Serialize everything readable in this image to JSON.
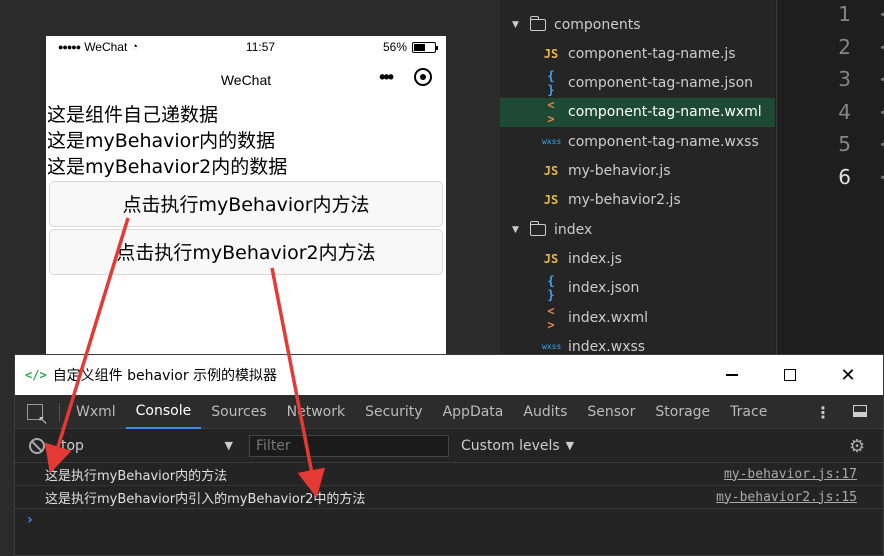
{
  "phone": {
    "status": {
      "signal": "●●●●●",
      "carrier": "WeChat",
      "time": "11:57",
      "battery": "56%",
      "battery_level": 0.56
    },
    "nav_title": "WeChat",
    "texts": [
      "这是组件自己递数据",
      "这是myBehavior内的数据",
      "这是myBehavior2内的数据"
    ],
    "buttons": [
      "点击执行myBehavior内方法",
      "点击执行myBehavior2内方法"
    ]
  },
  "tree": {
    "items": [
      {
        "type": "folder",
        "label": "components",
        "icon": "folder-icon"
      },
      {
        "type": "js",
        "label": "component-tag-name.js",
        "icon": "js-file-icon",
        "glyph": "JS"
      },
      {
        "type": "json",
        "label": "component-tag-name.json",
        "icon": "json-file-icon",
        "glyph": "{ }"
      },
      {
        "type": "wxml",
        "label": "component-tag-name.wxml",
        "icon": "wxml-file-icon",
        "glyph": "< >",
        "selected": true
      },
      {
        "type": "wxss",
        "label": "component-tag-name.wxss",
        "icon": "wxss-file-icon",
        "glyph": "wxss"
      },
      {
        "type": "js",
        "label": "my-behavior.js",
        "icon": "js-file-icon",
        "glyph": "JS"
      },
      {
        "type": "js",
        "label": "my-behavior2.js",
        "icon": "js-file-icon",
        "glyph": "JS"
      },
      {
        "type": "folder",
        "label": "index",
        "icon": "folder-icon"
      },
      {
        "type": "js",
        "label": "index.js",
        "icon": "js-file-icon",
        "glyph": "JS"
      },
      {
        "type": "json",
        "label": "index.json",
        "icon": "json-file-icon",
        "glyph": "{ }"
      },
      {
        "type": "wxml",
        "label": "index.wxml",
        "icon": "wxml-file-icon",
        "glyph": "< >"
      },
      {
        "type": "wxss",
        "label": "index.wxss",
        "icon": "wxss-file-icon",
        "glyph": "wxss"
      }
    ]
  },
  "editor": {
    "line_numbers": [
      "1",
      "2",
      "3",
      "4",
      "5",
      "6"
    ],
    "active_line": "6",
    "line_marker": "<"
  },
  "debug": {
    "title": "自定义组件 behavior 示例的模拟器",
    "title_icon": "</>",
    "tabs": [
      "Wxml",
      "Console",
      "Sources",
      "Network",
      "Security",
      "AppData",
      "Audits",
      "Sensor",
      "Storage",
      "Trace"
    ],
    "active_tab": "Console",
    "context": "top",
    "filter_placeholder": "Filter",
    "levels": "Custom levels",
    "logs": [
      {
        "message": "这是执行myBehavior内的方法",
        "source": "my-behavior.js:17"
      },
      {
        "message": "这是执行myBehavior内引入的myBehavior2中的方法",
        "source": "my-behavior2.js:15"
      }
    ],
    "prompt": "›"
  },
  "colors": {
    "accent": "#3c8be8",
    "arrow": "#e53935",
    "selected_row": "#1e4a35"
  }
}
